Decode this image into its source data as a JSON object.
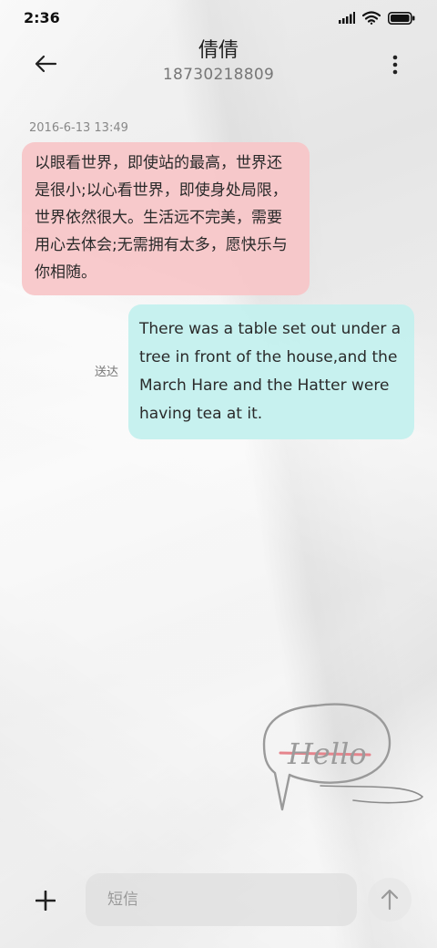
{
  "status_bar": {
    "time": "2:36"
  },
  "header": {
    "contact_name": "倩倩",
    "contact_number": "18730218809"
  },
  "messages": [
    {
      "direction": "incoming",
      "timestamp": "2016-6-13 13:49",
      "text": "以眼看世界，即使站的最高，世界还是很小;以心看世界，即使身处局限，世界依然很大。生活远不完美，需要用心去体会;无需拥有太多，愿快乐与你相随。"
    },
    {
      "direction": "outgoing",
      "status": "送达",
      "text": "There was a table set out under a tree in front of the house,and the March Hare and the Hatter were having tea at it."
    }
  ],
  "sticker": {
    "text": "Hello"
  },
  "composer": {
    "placeholder": "短信"
  },
  "colors": {
    "incoming_bubble": "#f7c5c8",
    "outgoing_bubble": "#c4f0ee",
    "sticker_accent": "#e5848c"
  }
}
